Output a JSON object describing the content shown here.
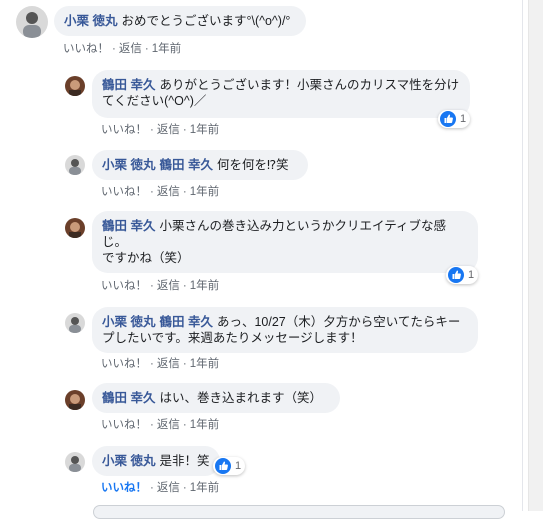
{
  "comments": [
    {
      "author": "小栗 徳丸",
      "mention": "",
      "text": "おめでとうございます°\\(^o^)/°",
      "like": "いいね！",
      "reply": "返信",
      "time": "1年前"
    },
    {
      "author": "鶴田 幸久",
      "mention": "",
      "text": "ありがとうございます！小栗さんのカリスマ性を分けてください(^O^)／",
      "like": "いいね！",
      "reply": "返信",
      "time": "1年前",
      "reactions": "1"
    },
    {
      "author": "小栗 徳丸",
      "mention": "鶴田 幸久",
      "text": "何を何を⁉笑",
      "like": "いいね！",
      "reply": "返信",
      "time": "1年前"
    },
    {
      "author": "鶴田 幸久",
      "mention": "",
      "text": "小栗さんの巻き込み力というかクリエイティブな感じ。",
      "text2": "ですかね（笑）",
      "like": "いいね！",
      "reply": "返信",
      "time": "1年前",
      "reactions": "1"
    },
    {
      "author": "小栗 徳丸",
      "mention": "鶴田 幸久",
      "text": "あっ、10/27（木）夕方から空いてたらキープしたいです。来週あたりメッセージします！",
      "like": "いいね！",
      "reply": "返信",
      "time": "1年前"
    },
    {
      "author": "鶴田 幸久",
      "mention": "",
      "text": "はい、巻き込まれます（笑）",
      "like": "いいね！",
      "reply": "返信",
      "time": "1年前"
    },
    {
      "author": "小栗 徳丸",
      "mention": "",
      "text": "是非！笑",
      "like": "いいね！",
      "reply": "返信",
      "time": "1年前",
      "reactions": "1"
    }
  ],
  "colors": {
    "link": "#385898",
    "like_blue": "#1877f2",
    "bubble": "#f0f2f5"
  },
  "icons": {
    "like": "thumbs-up-icon"
  }
}
